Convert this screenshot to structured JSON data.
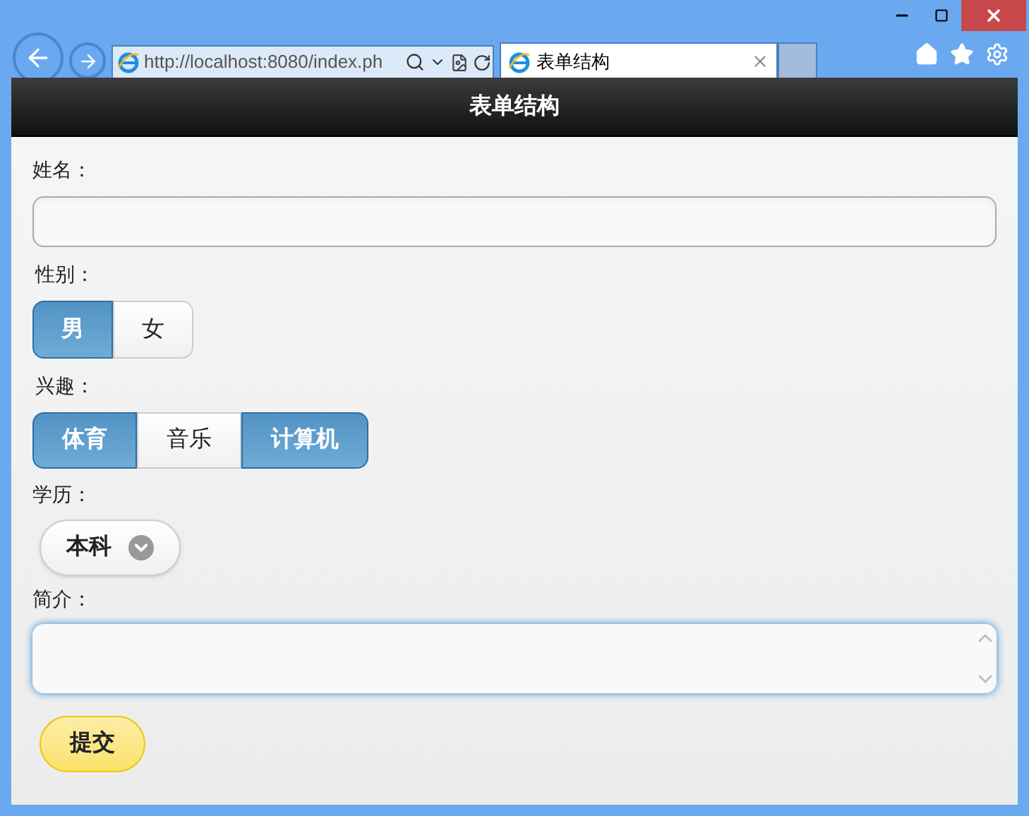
{
  "browser": {
    "address": "http://localhost:8080/index.ph",
    "tab": {
      "title": "表单结构",
      "selected": true
    }
  },
  "header": {
    "title": "表单结构"
  },
  "form": {
    "name": {
      "label": "姓名："
    },
    "gender": {
      "label": "性别：",
      "options": [
        {
          "label": "男",
          "selected": true
        },
        {
          "label": "女",
          "selected": false
        }
      ]
    },
    "interests": {
      "label": "兴趣：",
      "options": [
        {
          "label": "体育",
          "checked": true
        },
        {
          "label": "音乐",
          "checked": false
        },
        {
          "label": "计算机",
          "checked": true
        }
      ]
    },
    "education": {
      "label": "学历：",
      "value": "本科"
    },
    "bio": {
      "label": "简介："
    },
    "submit": "提交"
  }
}
